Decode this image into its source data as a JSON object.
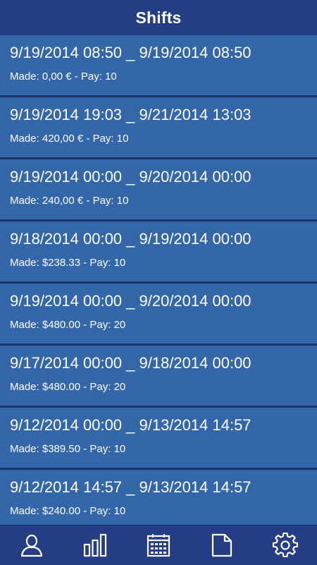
{
  "header": {
    "title": "Shifts"
  },
  "shifts": [
    {
      "dates": "9/19/2014 08:50 _ 9/19/2014 08:50",
      "summary": "Made: 0,00 € - Pay: 10"
    },
    {
      "dates": "9/19/2014 19:03 _ 9/21/2014 13:03",
      "summary": "Made: 420,00 € - Pay: 10"
    },
    {
      "dates": "9/19/2014 00:00 _ 9/20/2014 00:00",
      "summary": "Made: 240,00 € - Pay: 10"
    },
    {
      "dates": "9/18/2014 00:00 _ 9/19/2014 00:00",
      "summary": "Made: $238.33 - Pay: 10"
    },
    {
      "dates": "9/19/2014 00:00 _ 9/20/2014 00:00",
      "summary": "Made: $480.00 - Pay: 20"
    },
    {
      "dates": "9/17/2014 00:00 _ 9/18/2014 00:00",
      "summary": "Made: $480.00 - Pay: 20"
    },
    {
      "dates": "9/12/2014 00:00 _ 9/13/2014 14:57",
      "summary": "Made: $389.50 - Pay: 10"
    },
    {
      "dates": "9/12/2014 14:57 _ 9/13/2014 14:57",
      "summary": "Made: $240.00 - Pay: 10"
    }
  ],
  "navbar": {
    "items": [
      {
        "icon": "user-icon"
      },
      {
        "icon": "bar-chart-icon"
      },
      {
        "icon": "calendar-icon"
      },
      {
        "icon": "document-icon"
      },
      {
        "icon": "gear-icon"
      }
    ]
  },
  "colors": {
    "header_bg": "#243d85",
    "row_bg": "#3466aa",
    "row_divider": "#1c3466",
    "text": "#ffffff"
  }
}
